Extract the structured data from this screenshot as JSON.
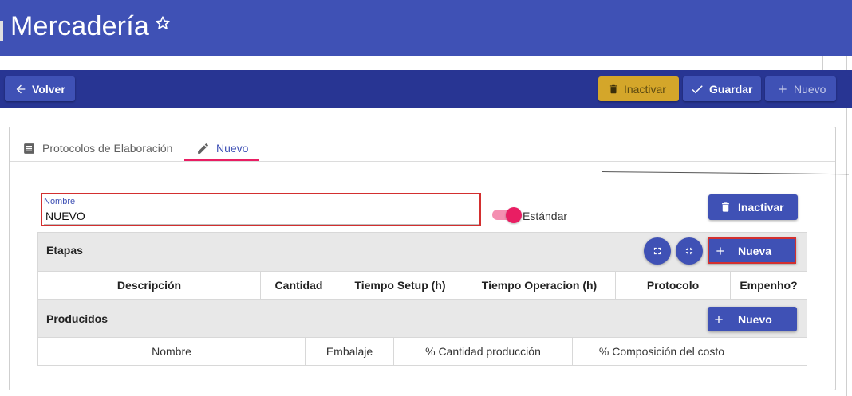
{
  "header": {
    "title": "Mercadería"
  },
  "toolbar": {
    "back_label": "Volver",
    "inactivate_label": "Inactivar",
    "save_label": "Guardar",
    "new_label": "Nuevo"
  },
  "tabs": [
    {
      "label": "Protocolos de Elaboración",
      "icon": "list-icon"
    },
    {
      "label": "Nuevo",
      "icon": "pencil-icon"
    }
  ],
  "form": {
    "name_label": "Nombre",
    "name_value": "NUEVO",
    "standard_label": "Estándar",
    "standard_on": true,
    "inactivate_label": "Inactivar"
  },
  "stages": {
    "title": "Etapas",
    "new_label": "Nueva",
    "columns": [
      "Descripción",
      "Cantidad",
      "Tiempo Setup (h)",
      "Tiempo Operacion (h)",
      "Protocolo",
      "Empenho?"
    ]
  },
  "produced": {
    "title": "Producidos",
    "new_label": "Nuevo",
    "columns": [
      "Nombre",
      "Embalaje",
      "% Cantidad producción",
      "% Composición del costo",
      ""
    ]
  },
  "colors": {
    "primary": "#3f51b5",
    "toolbar": "#283593",
    "warning": "#d4a62a",
    "accent": "#e91e63",
    "highlight": "#d32f2f"
  }
}
